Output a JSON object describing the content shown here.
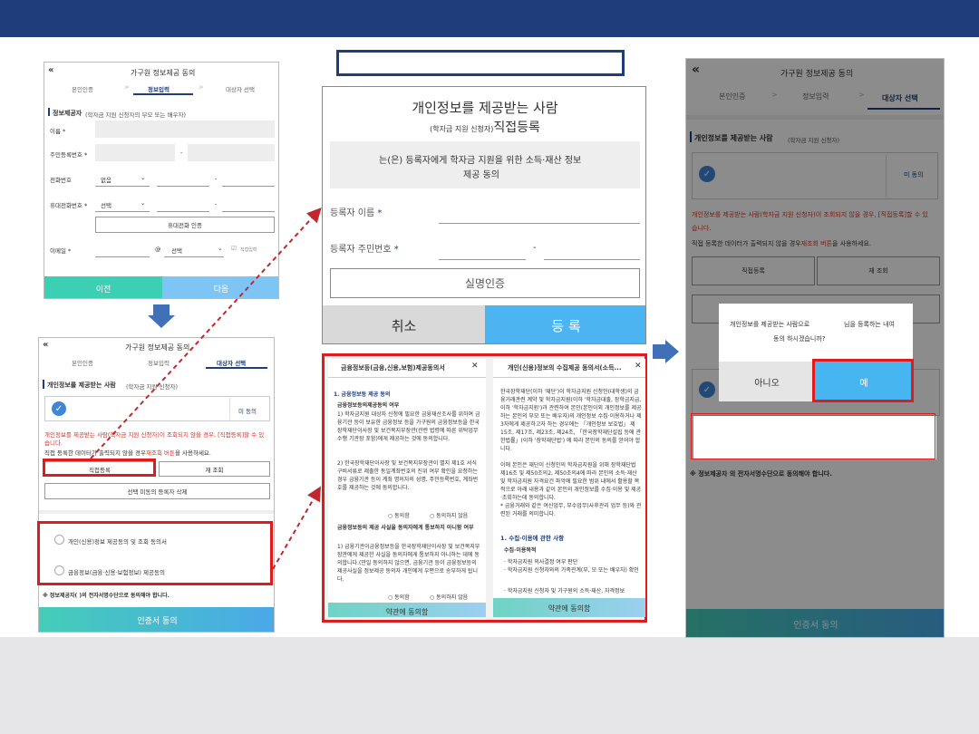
{
  "colors": {
    "header": "#1f3d7a",
    "accent": "#3f86d6",
    "red": "#e01b1b",
    "teal": "#3ccfb4",
    "sky": "#7ec4f5",
    "bottom": "#e6e6e8"
  },
  "screen1": {
    "title": "가구원 정보제공 동의",
    "steps": [
      "본인인증",
      "정보입력",
      "대상자 선택"
    ],
    "section": "정보제공자",
    "section_note": "(학자금 지원 신청자의 부모 또는 배우자)",
    "name_label": "이름 *",
    "rrn_label": "주민등록번호 *",
    "phone_label": "전화번호",
    "phone_select": "없음",
    "mobile_label": "휴대전화번호 *",
    "mobile_select": "선택",
    "verify_btn": "휴대전화 인증",
    "email_label": "이메일 *",
    "email_at": "@",
    "email_select": "선택",
    "direct_input": "직접입력",
    "prev": "이전",
    "next": "다음"
  },
  "screen2": {
    "title": "가구원 정보제공 동의",
    "steps": [
      "본인인증",
      "정보입력",
      "대상자 선택"
    ],
    "section": "개인정보를 제공받는 사람",
    "section_note": "(학자금 지원 신청자)",
    "check_status": "미 동의",
    "warn1": "개인정보를 제공받는 사람(학자금 지원 신청자)이 조회되지 않을 경우, [직접등록]할 수 있",
    "warn2": "습니다.",
    "info_pre": "직접 등록한 데이터가 출력되지 않을 경우",
    "info_red": "재조회 버튼",
    "info_post": "을 사용하세요.",
    "direct_btn": "직접등록",
    "requery_btn": "재 조회",
    "delete_btn": "선택 미동의 등록자 삭제",
    "consent1": "개인(신용)정보 제공동의 및 조회 동의서",
    "consent2": "금융정보(금융·신용·보험정보) 제공동의",
    "footnote": "※ 정보제공자(      )의 전자서명수단으로 동의해야 합니다.",
    "cert_btn": "인증서 동의"
  },
  "popup": {
    "title": "개인정보를 제공받는 사람",
    "subtitle_note": "(학자금 지원 신청자)",
    "subtitle": "직접등록",
    "consent_text": "는(은) 등록자에게 학자금 지원을 위한 소득·재산 정보",
    "consent_text2": "제공 동의",
    "reg_name": "등록자 이름",
    "reg_rrn": "등록자 주민번호",
    "required_mark": "*",
    "dash": "-",
    "verify": "실명인증",
    "cancel": "취소",
    "register": "등 록"
  },
  "doc1": {
    "title": "금융정보등(금융,신용,보험)제공동의서",
    "h1": "1. 금융정보등 제공 동의",
    "h2": "금융정보등의제공동의 여부",
    "p1": "1) 학자금지원 대상자 신청에 필요한 금융재산조사를 위하여 금융기관 등이 보유한 금융정보 등을 가구원의 금융정보등을 한국장학재단이사장 및 보건복지부장관(관련 법령에 따른 위탁업무수행 기관장 포함)에게 제공하는 것에 동의합니다.",
    "p2": "2) 한국장학재단이사장 및 보건복지부장관이 별지 제1호 서식 구비서류로 제출한 동일계좌번호의 진위 여부 확인을 요청하는 경우 금융기관 등이 계좌 명의자의 성명, 주민등록번호, 계좌번호를 제공하는 것에 동의합니다.",
    "agree": "동의함",
    "disagree": "동의하지 않음",
    "h3": "금융정보등의 제공 사실을 동의자에게 통보하지 아니함 여부",
    "p3": "1) 금융기관이금융정보등을 한국장학재단이사장 및 보건복지부장관에게 제공한 사실을 동의자에게 통보하지 아니하는 데에 동의합니다.(만일 동의하지 않으면, 금융기관 등이 금융정보등의 제공사실을 정보제공 동의자 개인에게 우편으로 송부하게 됩니다.",
    "btn": "약관에 동의함"
  },
  "doc2": {
    "title": "개인(신용)정보의 수집제공 동의서(소득...",
    "p1": "한국장학재단(이하 '재단')이 학자금지원 신청인(대학생)의 금융거래관련 계약 및 학자금지원(이하 '학자금대출, 장학금지급, 이하 '학자금지원')과 관련하여 본인(본인이외 개인정보를 제공하는 본인의 부모 또는 배우자)의 개인정보 수집·이용하거나 제3자에게 제공하고자 하는 경우에는 「개인정보 보호법」 제15조, 제17조, 제23조, 제24조, 「한국장학재단설립 등에 관한법률」(이하 '장학재단법') 에 따라 본인의 동의를 얻어야 합니다.",
    "p2": "이에 본인은 재단이 신청인의 학자금지원을 위해 장학재단법 제16조 및 제50조의2, 제50조의4에 따라 본인의 소득·재산 및 학자금지원 자격요건 파악에 필요한 범위 내에서 활용할 목적으로 아래 내용과 같이 본인의 개인정보를 수집·이용 및 제공·조회하는데 동의합니다.",
    "p3": "* 금융거래와 같은 여신업무, 부수업무(사후관리 업무 등)와 관련된 거래를 의미합니다.",
    "h1": "1. 수집·이용에 관한 사항",
    "h2": "수집·이용목적",
    "b1": "· 학자금지원 의사결정 여부 판단",
    "b2": "· 학자금지원 신청자와의 가족관계(부, 모 또는 배우자) 확인",
    "b3": "· 학자금지원 신청자 및 가구원의 소득·재산, 자격정보",
    "btn": "약관에 동의함"
  },
  "screen3": {
    "title": "가구원 정보제공 동의",
    "steps": [
      "본인인증",
      "정보입력",
      "대상자 선택"
    ],
    "section": "개인정보를 제공받는 사람",
    "section_note": "(학자금 지원 신청자)",
    "check_status": "미 동의",
    "warn1": "개인정보를 제공받는 사람(학자금 지원 신청자)이 조회되지 않을 경우, [직접등록]할 수 있",
    "warn2": "습니다.",
    "info_pre": "직접 등록한 데이터가 출력되지 않을 경우",
    "info_red": "재조회 버튼",
    "info_post": "을 사용하세요.",
    "direct_btn": "직접등록",
    "requery_btn": "재 조회",
    "footnote": "※ 정보제공자       의 전자서명수단으로 동의해야 합니다.",
    "cert_btn": "인증서 동의",
    "dialog_line1a": "개인정보를 제공받는 사람으로",
    "dialog_line1b": "님을 등록하는 내여",
    "dialog_line2": "동의 하시겠습니까?",
    "no": "아니오",
    "yes": "예"
  }
}
